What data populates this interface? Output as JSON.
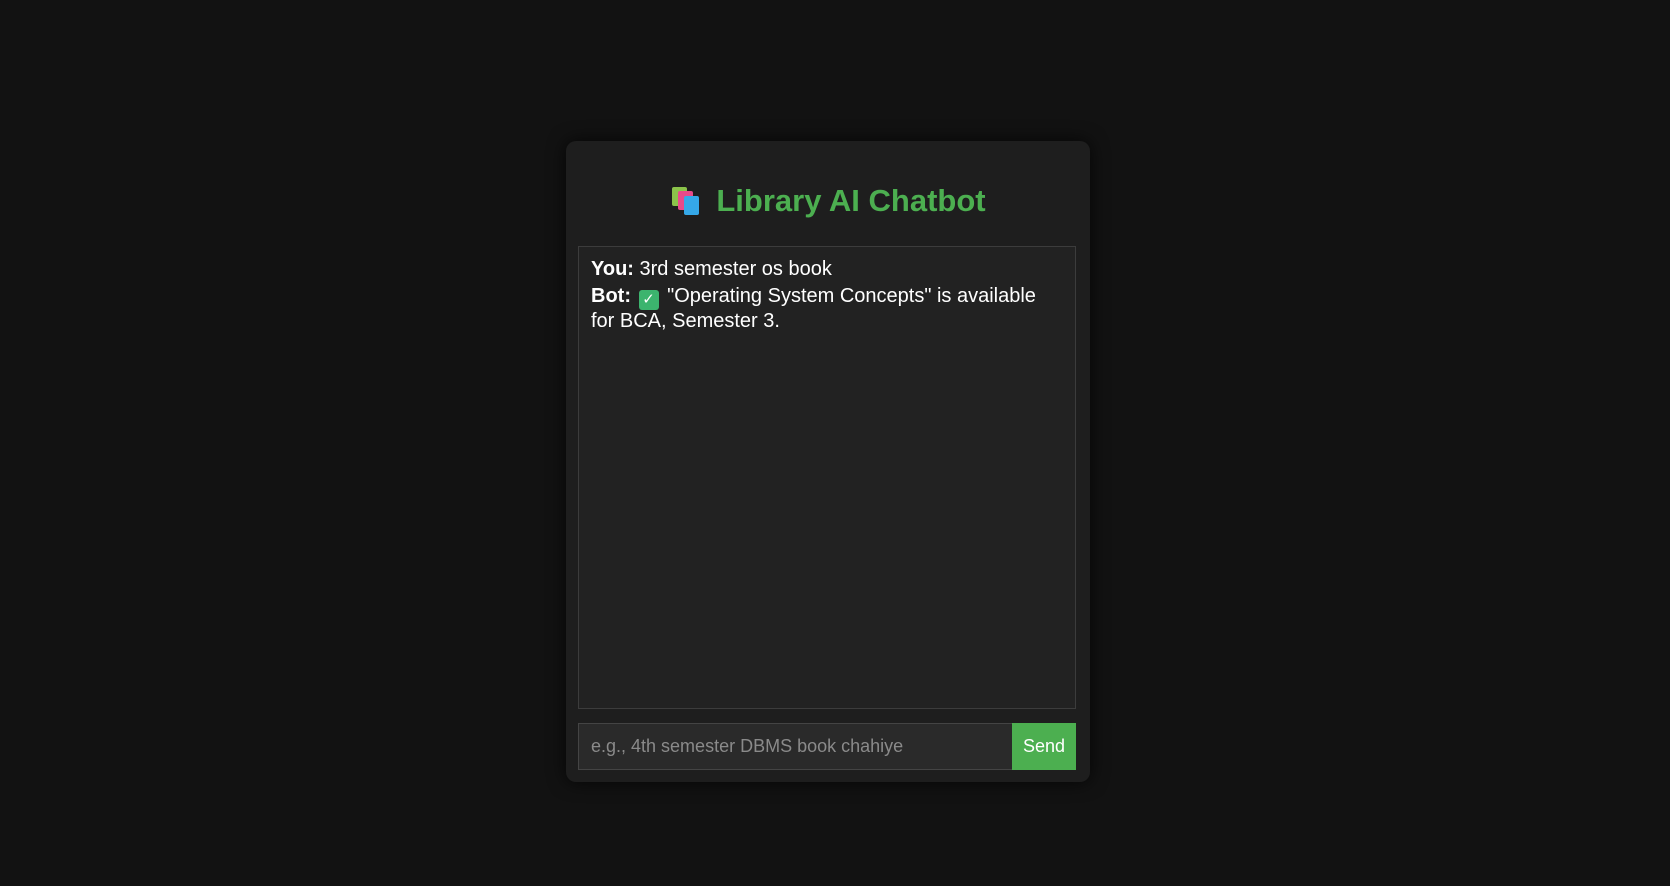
{
  "header": {
    "title": "Library AI Chatbot",
    "icon": "books-icon",
    "accent_color": "#4caf50"
  },
  "chat": {
    "messages": [
      {
        "sender": "You:",
        "text": "3rd semester os book",
        "icon": ""
      },
      {
        "sender": "Bot:",
        "text": "\"Operating System Concepts\" is available for BCA, Semester 3.",
        "icon": "check-icon"
      }
    ]
  },
  "input": {
    "value": "",
    "placeholder": "e.g., 4th semester DBMS book chahiye"
  },
  "send_button": {
    "label": "Send"
  }
}
